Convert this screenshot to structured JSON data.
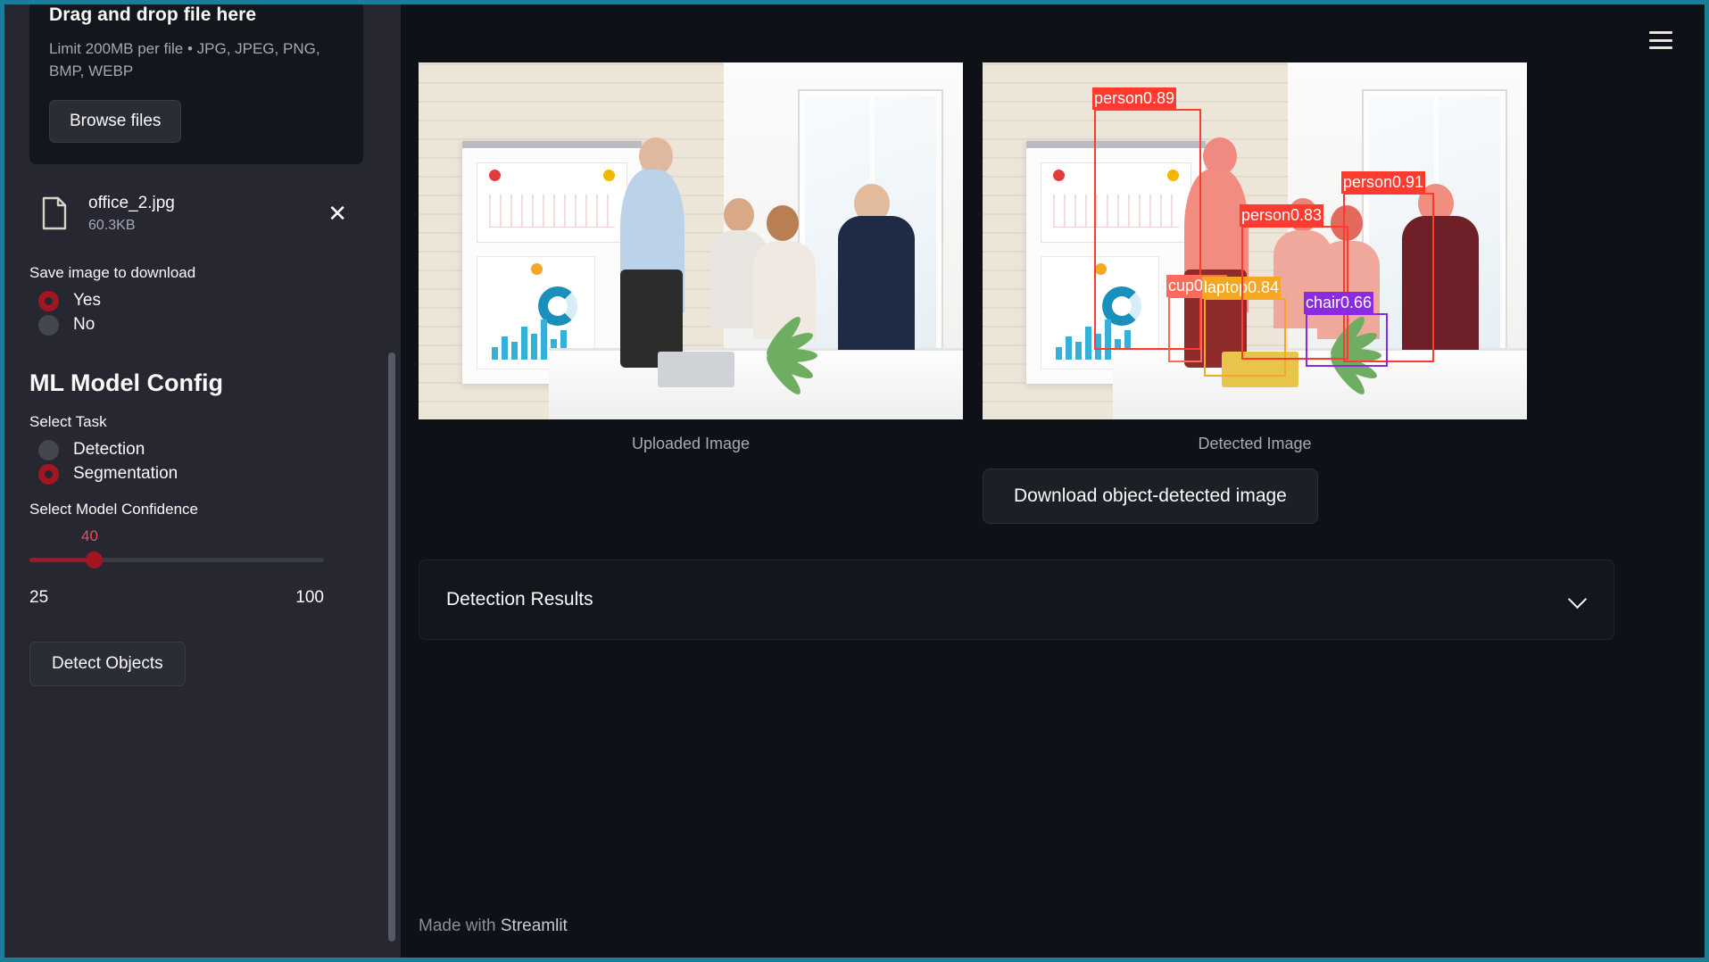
{
  "app": {
    "theme_accent": "#a31621",
    "sidebar_bg": "#262730",
    "main_bg": "#0e1117",
    "border_color": "#1a7f96"
  },
  "sidebar": {
    "uploader": {
      "title": "Drag and drop file here",
      "limits": "Limit 200MB per file • JPG, JPEG, PNG, BMP, WEBP",
      "browse_label": "Browse files",
      "file": {
        "icon": "document-icon",
        "name": "office_2.jpg",
        "size": "60.3KB",
        "remove_icon": "close-icon"
      }
    },
    "save_image": {
      "label": "Save image to download",
      "options": [
        "Yes",
        "No"
      ],
      "selected": "Yes"
    },
    "model_config": {
      "title": "ML Model Config",
      "task": {
        "label": "Select Task",
        "options": [
          "Detection",
          "Segmentation"
        ],
        "selected": "Segmentation"
      },
      "confidence": {
        "label": "Select Model Confidence",
        "value": "40",
        "min": "25",
        "max": "100"
      },
      "detect_button": "Detect Objects"
    }
  },
  "header": {
    "menu_icon": "hamburger-menu-icon"
  },
  "main": {
    "uploaded_caption": "Uploaded Image",
    "detected_caption": "Detected Image",
    "download_button": "Download object-detected image",
    "expander": {
      "title": "Detection Results",
      "chevron_icon": "chevron-down-icon",
      "expanded": false
    },
    "detections": [
      {
        "label": "person0.89",
        "color": "#ff3b30"
      },
      {
        "label": "cup0.47",
        "color": "#ff6b5a"
      },
      {
        "label": "laptop0.84",
        "color": "#f5a623"
      },
      {
        "label": "person0.83",
        "color": "#ff3b30"
      },
      {
        "label": "person0.91",
        "color": "#ff3b30"
      },
      {
        "label": "chair0.66",
        "color": "#8a2be2"
      }
    ]
  },
  "footer": {
    "made_with": "Made with ",
    "brand": "Streamlit"
  }
}
